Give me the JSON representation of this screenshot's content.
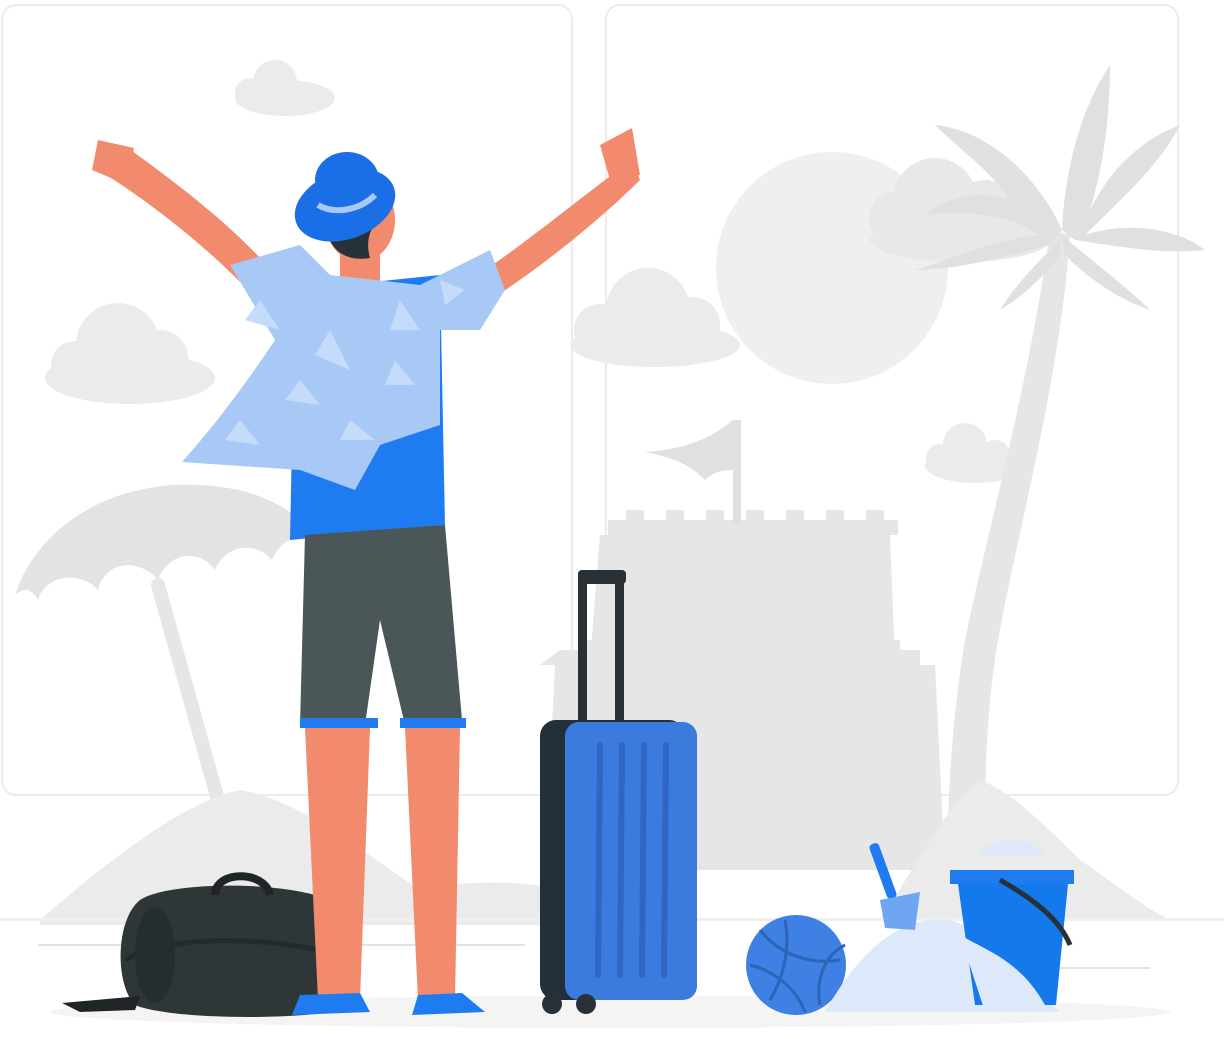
{
  "illustration": {
    "subject": "traveler-arriving-at-beach",
    "colors": {
      "background": "#ffffff",
      "panel_border": "#e9e9e9",
      "scenery_gray": "#ebebeb",
      "scenery_dark_gray": "#dedede",
      "skin": "#f28b6e",
      "hat_blue": "#1a6fe6",
      "shirt_light_blue": "#a8c8f5",
      "tshirt_blue": "#1f7cf0",
      "shorts_gray": "#4b5659",
      "suitcase_blue": "#3b7bdd",
      "suitcase_handle": "#2a3136",
      "bag_dark": "#2f3638",
      "bucket_blue": "#1479ea",
      "sand_light": "#dde9fb",
      "ball_blue": "#3e80e4"
    },
    "icons": [
      "cloud-icon",
      "sun-icon",
      "palm-tree-icon",
      "umbrella-icon",
      "sand-castle-icon",
      "flag-icon",
      "suitcase-icon",
      "duffel-bag-icon",
      "volleyball-icon",
      "bucket-icon",
      "shovel-icon"
    ]
  }
}
